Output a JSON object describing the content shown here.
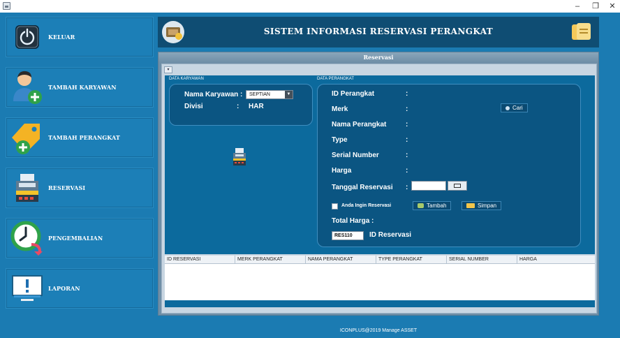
{
  "window": {
    "min": "–",
    "max": "❐",
    "close": "✕"
  },
  "sidebar": {
    "items": [
      {
        "label": "KELUAR",
        "icon": "power-icon"
      },
      {
        "label": "TAMBAH KARYAWAN",
        "icon": "add-user-icon"
      },
      {
        "label": "TAMBAH PERANGKAT",
        "icon": "add-tag-icon"
      },
      {
        "label": "RESERVASI",
        "icon": "cash-register-icon"
      },
      {
        "label": "PENGEMBALIAN",
        "icon": "clock-return-icon"
      },
      {
        "label": "LAPORAN",
        "icon": "monitor-alert-icon"
      }
    ]
  },
  "header": {
    "title": "SISTEM INFORMASI RESERVASI PERANGKAT"
  },
  "frame": {
    "title": "Reservasi"
  },
  "data_karyawan": {
    "caption": "DATA KARYAWAN",
    "nama_label": "Nama Karyawan :",
    "nama_value": "SEPTIAN",
    "divisi_label": "Divisi",
    "divisi_sep": ":",
    "divisi_value": "HAR"
  },
  "data_perangkat": {
    "caption": "DATA PERANGKAT",
    "fields": [
      {
        "label": "ID Perangkat",
        "sep": ":"
      },
      {
        "label": "Merk",
        "sep": ":"
      },
      {
        "label": "Nama Perangkat",
        "sep": ":"
      },
      {
        "label": "Type",
        "sep": ":"
      },
      {
        "label": "Serial Number",
        "sep": ":"
      },
      {
        "label": "Harga",
        "sep": ":"
      },
      {
        "label": "Tanggal Reservasi",
        "sep": ":"
      }
    ],
    "cari_label": "Cari",
    "checkbox_label": "Anda Ingin Reservasi",
    "tambah_label": "Tambah",
    "simpan_label": "Simpan",
    "total_label": "Total Harga :",
    "id_reservasi_value": "RES110",
    "id_reservasi_label": "ID Reservasi"
  },
  "table": {
    "columns": [
      "ID RESERVASI",
      "MERK PERANGKAT",
      "NAMA PERANGKAT",
      "TYPE PERANGKAT",
      "SERIAL NUMBER",
      "HARGA"
    ]
  },
  "footer": {
    "text": "ICONPLUS@2019 Manage ASSET"
  },
  "colors": {
    "app_bg": "#1b7bb2",
    "header_bg": "#0f4d73",
    "panel_bg": "#0b5582",
    "work_bg": "#0c6a9d"
  }
}
